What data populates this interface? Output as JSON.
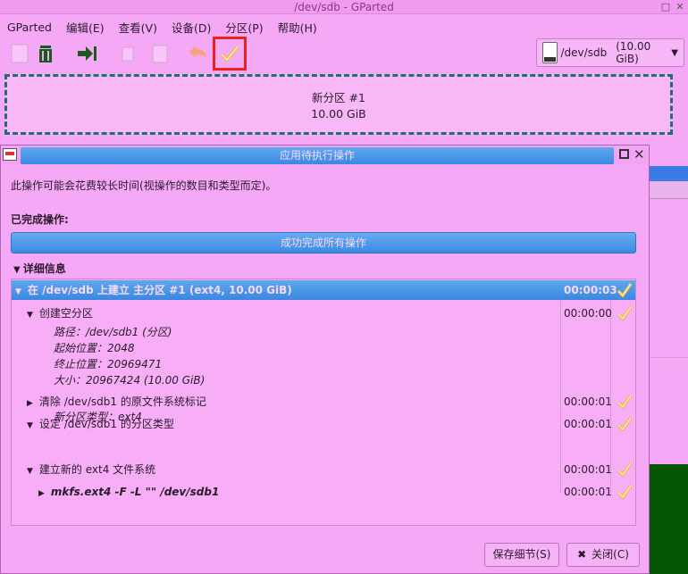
{
  "window": {
    "title": "/dev/sdb - GParted",
    "menus": [
      "GParted",
      "编辑(E)",
      "查看(V)",
      "设备(D)",
      "分区(P)",
      "帮助(H)"
    ],
    "device": "/dev/sdb",
    "device_size": "(10.00 GiB)"
  },
  "toolbar": {
    "icons": [
      "new-partition-icon",
      "delete-icon",
      "resize-move-icon",
      "copy-icon",
      "paste-icon",
      "undo-icon",
      "apply-icon"
    ],
    "highlighted": "apply-icon",
    "highlight_color": "#e8241c"
  },
  "partition_map": {
    "name": "新分区 #1",
    "size": "10.00 GiB"
  },
  "dialog": {
    "title": "应用待执行操作",
    "warning": "此操作可能会花费较长时间(视操作的数目和类型而定)。",
    "completed_label": "已完成操作:",
    "progress_text": "成功完成所有操作",
    "progress": 1.0,
    "details_label": "详细信息",
    "save_button": "保存细节(S)",
    "close_button": "关闭(C)",
    "close_symbol": "✖",
    "rows": [
      {
        "text": "在 /dev/sdb 上建立 主分区 #1 (ext4, 10.00 GiB)",
        "time": "00:00:03"
      },
      {
        "text": "创建空分区",
        "time": "00:00:00"
      },
      {
        "text": "清除 /dev/sdb1 的原文件系统标记",
        "time": "00:00:01"
      },
      {
        "text": "设定 /dev/sdb1 的分区类型",
        "time": "00:00:01"
      },
      {
        "text": "建立新的 ext4 文件系统",
        "time": "00:00:01"
      },
      {
        "text": "mkfs.ext4 -F -L \"\" /dev/sdb1",
        "time": "00:00:01"
      }
    ],
    "create_info": [
      "路径：/dev/sdb1 (分区)",
      "起始位置：2048",
      "终止位置：20969471",
      "大小：20967424 (10.00 GiB)"
    ],
    "type_info": "新分区类型：ext4"
  },
  "colors": {
    "accent": "#3a88e0",
    "background": "#f5a8f5",
    "check": "#e8b84a"
  }
}
